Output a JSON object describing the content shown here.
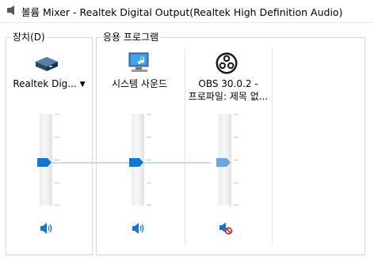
{
  "window": {
    "title": "볼륨 Mixer - Realtek Digital Output(Realtek High Definition Audio)"
  },
  "device_group": {
    "label": "장치(D)",
    "device_name": "Realtek Dig...",
    "volume_percent": 48
  },
  "apps_group": {
    "label": "응용 프로그램",
    "apps": [
      {
        "name": "시스템 사운드",
        "volume_percent": 48,
        "muted": false,
        "icon": "system-sounds-icon"
      },
      {
        "name_line1": "OBS 30.0.2 -",
        "name_line2": "프로파일: 제목 없...",
        "volume_percent": 48,
        "muted": true,
        "icon": "obs-icon"
      }
    ]
  },
  "colors": {
    "accent": "#1476d2",
    "muted_thumb": "#6aa6e0",
    "mute_red": "#d62020"
  }
}
